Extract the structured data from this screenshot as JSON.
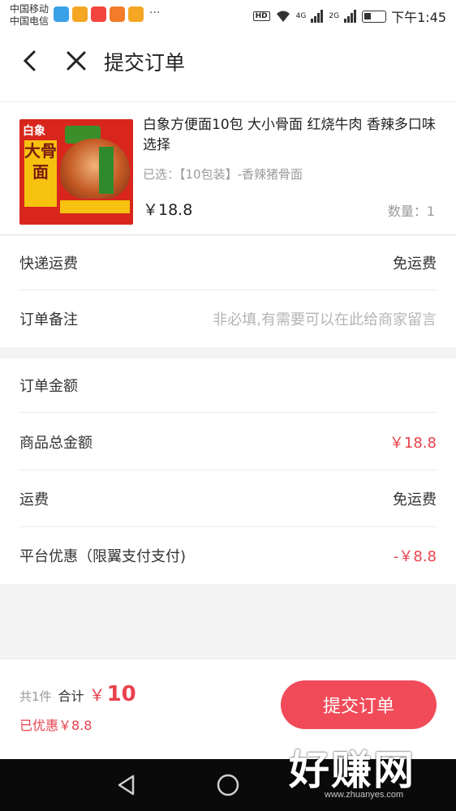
{
  "status_bar": {
    "carrier1": "中国移动",
    "carrier2": "中国电信",
    "dots": "···",
    "hd": "HD",
    "net1": "4G",
    "net2": "2G",
    "time": "下午1:45",
    "notif_colors": [
      "#3aa0e8",
      "#f5a623",
      "#f2453d",
      "#f27c2a",
      "#f5a623"
    ]
  },
  "nav": {
    "title": "提交订单"
  },
  "product": {
    "name": "白象方便面10包 大小骨面 红烧牛肉 香辣多口味选择",
    "spec": "已选：【10包装】-香辣猪骨面",
    "price": "￥18.8",
    "qty": "数量：1",
    "img_logo": "白象",
    "img_big": "大骨面"
  },
  "shipping": {
    "label": "快递运费",
    "value": "免运费"
  },
  "remark": {
    "label": "订单备注",
    "placeholder": "非必填,有需要可以在此给商家留言"
  },
  "amount": {
    "title": "订单金额",
    "goods_label": "商品总金额",
    "goods_value": "￥18.8",
    "freight_label": "运费",
    "freight_value": "免运费",
    "discount_label": "平台优惠（限翼支付支付)",
    "discount_value": "-￥8.8"
  },
  "footer": {
    "count": "共1件",
    "total_label": "合计",
    "currency": "￥",
    "total_value": "10",
    "discount": "已优惠￥8.8",
    "submit": "提交订单"
  },
  "watermark": {
    "big": "好赚网",
    "small": "www.zhuanyes.com"
  },
  "colors": {
    "accent": "#f14b59",
    "price_red": "#e8424d"
  }
}
